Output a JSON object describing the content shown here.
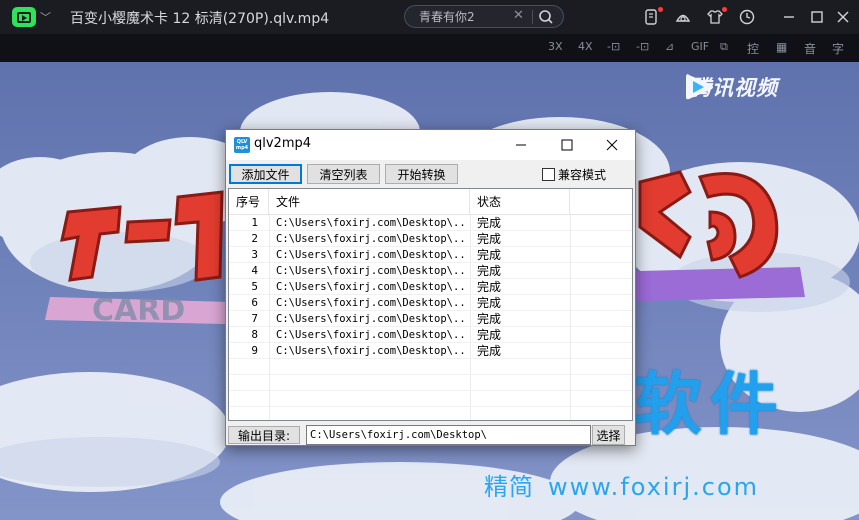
{
  "player": {
    "video_title": "百变小樱魔术卡 12 标清(270P).qlv.mp4",
    "search": {
      "value": "青春有你2",
      "clear_icon": "close-icon",
      "search_icon": "search-icon"
    },
    "title_icons": [
      "phone-icon",
      "skin-icon",
      "shirt-icon",
      "history-icon"
    ],
    "window_controls": [
      "minimize-icon",
      "maximize-icon",
      "close-icon"
    ]
  },
  "toolbar": {
    "items": [
      "3X",
      "4X",
      "-⊡",
      "-⊡",
      "⊿",
      "GIF",
      "⧉",
      "控",
      "▦",
      "音",
      "字"
    ]
  },
  "video": {
    "brand_text": "腾讯视频",
    "watermark_main": "佛系软件",
    "watermark_sub": "精简",
    "watermark_url": "www.foxirj.com",
    "colors": {
      "sky": "#6b7fb5",
      "cloud": "#e9eef7",
      "watermark": "#22a0ee"
    }
  },
  "dialog": {
    "title": "qlv2mp4",
    "buttons": {
      "add_file": "添加文件",
      "clear_list": "清空列表",
      "start_convert": "开始转换",
      "compat_mode": "兼容模式",
      "output_dir": "输出目录:",
      "select": "选择"
    },
    "columns": [
      "序号",
      "文件",
      "状态"
    ],
    "rows": [
      {
        "no": "1",
        "file": "C:\\Users\\foxirj.com\\Desktop\\...",
        "state": "完成"
      },
      {
        "no": "2",
        "file": "C:\\Users\\foxirj.com\\Desktop\\...",
        "state": "完成"
      },
      {
        "no": "3",
        "file": "C:\\Users\\foxirj.com\\Desktop\\...",
        "state": "完成"
      },
      {
        "no": "4",
        "file": "C:\\Users\\foxirj.com\\Desktop\\...",
        "state": "完成"
      },
      {
        "no": "5",
        "file": "C:\\Users\\foxirj.com\\Desktop\\...",
        "state": "完成"
      },
      {
        "no": "6",
        "file": "C:\\Users\\foxirj.com\\Desktop\\...",
        "state": "完成"
      },
      {
        "no": "7",
        "file": "C:\\Users\\foxirj.com\\Desktop\\...",
        "state": "完成"
      },
      {
        "no": "8",
        "file": "C:\\Users\\foxirj.com\\Desktop\\...",
        "state": "完成"
      },
      {
        "no": "9",
        "file": "C:\\Users\\foxirj.com\\Desktop\\...",
        "state": "完成"
      }
    ],
    "output_path": "C:\\Users\\foxirj.com\\Desktop\\"
  }
}
